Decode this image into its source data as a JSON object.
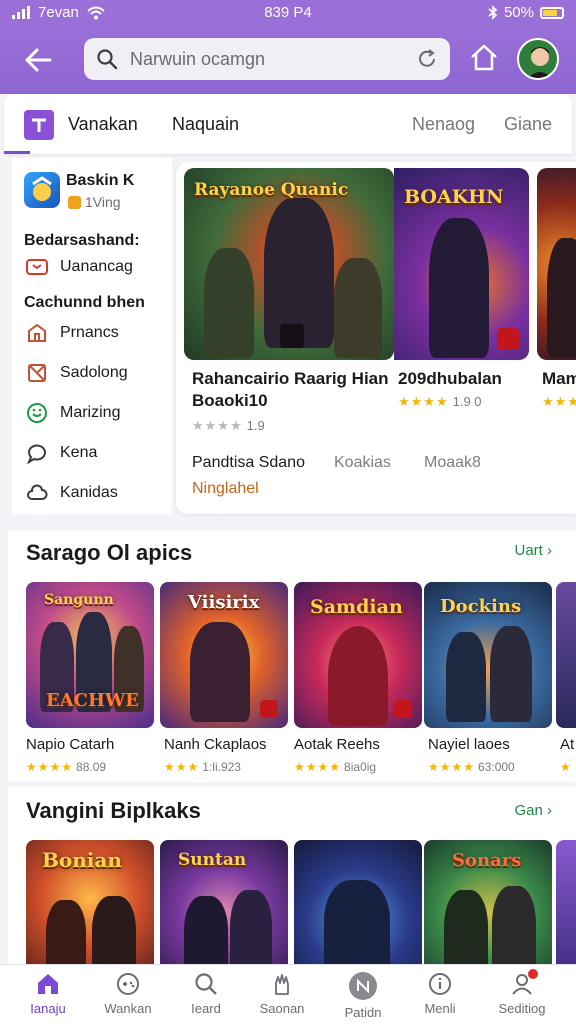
{
  "status": {
    "left": "7evan",
    "time": "839 P4",
    "battery": "50%"
  },
  "search": {
    "placeholder": "Narwuin ocamgn"
  },
  "tabs": [
    "Vanakan",
    "Naquain",
    "Nenaog",
    "Giane"
  ],
  "app": {
    "name": "Baskin K",
    "sub": "1Ving"
  },
  "left_panel": {
    "heading1": "Bedarsashand:",
    "item1": "Uanancag",
    "heading2": "Cachunnd bhen",
    "items": [
      "Prnancs",
      "Sadolong",
      "Marizing",
      "Kena",
      "Kanidas"
    ]
  },
  "featured": [
    {
      "art": "Rayanoe Quanic",
      "title_line1": "Rahancairio Raarig Hian",
      "title_line2": "Boaoki10",
      "stars": "★★★★",
      "rating": "1.9"
    },
    {
      "art": "BOAKHN",
      "title_line1": "209dhubalan",
      "title_line2": "",
      "stars": "★★★★",
      "rating": "1.9 0"
    },
    {
      "art": "",
      "title_line1": "Mam",
      "title_line2": "",
      "stars": "★★★",
      "rating": ""
    }
  ],
  "featured_meta": {
    "label1": "Pandtisa Sdano",
    "label2": "Koakias",
    "label3": "Moaak8",
    "orange": "Ninglahel"
  },
  "section1": {
    "title": "Sarago Ol apics",
    "see_all": "Uart",
    "games": [
      {
        "art": "Sangunn",
        "art2": "EACHWE",
        "name": "Napio Catarh",
        "stars": "★★★★",
        "rating": "88.09"
      },
      {
        "art": "Viisirix",
        "art2": "",
        "name": "Nanh Ckaplaos",
        "stars": "★★★",
        "rating": "1:li.923"
      },
      {
        "art": "Samdian",
        "art2": "",
        "name": "Aotak Reehs",
        "stars": "★★★★",
        "rating": "8ia0ig"
      },
      {
        "art": "Dockins",
        "art2": "",
        "name": "Nayiel laoes",
        "stars": "★★★★",
        "rating": "63:000"
      },
      {
        "art": "",
        "art2": "",
        "name": "At",
        "stars": "★",
        "rating": ""
      }
    ]
  },
  "section2": {
    "title": "Vangini Biplkaks",
    "see_all": "Gan",
    "games": [
      {
        "art": "Bonian"
      },
      {
        "art": "Suntan"
      },
      {
        "art": ""
      },
      {
        "art": "Sonars"
      },
      {
        "art": ""
      }
    ]
  },
  "bottom_nav": [
    "Ianaju",
    "Wankan",
    "Ieard",
    "Saonan",
    "Patidn",
    "Menli",
    "Seditiog"
  ],
  "colors": {
    "purple": "#9a6fd8",
    "accent": "#7b4bd1",
    "green": "#1e8a44",
    "orange": "#c7631a",
    "star": "#f4b400"
  }
}
